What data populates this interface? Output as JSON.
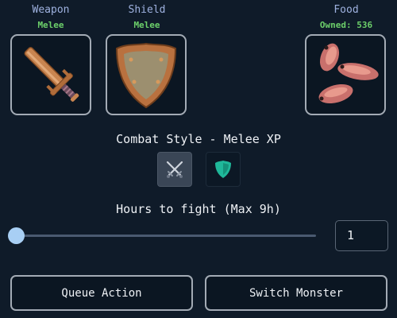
{
  "slots": [
    {
      "id": "weapon",
      "title": "Weapon",
      "subtitle": "Melee",
      "icon": "sword-icon"
    },
    {
      "id": "shield",
      "title": "Shield",
      "subtitle": "Melee",
      "icon": "shield-icon"
    },
    {
      "id": "food",
      "title": "Food",
      "subtitle": "Owned: 536",
      "icon": "fish-icon"
    }
  ],
  "combat_style": {
    "label": "Combat Style - Melee XP",
    "options": [
      {
        "icon": "crossed-swords-icon",
        "selected": true
      },
      {
        "icon": "green-shield-icon",
        "selected": false
      }
    ]
  },
  "hours": {
    "label": "Hours to fight (Max 9h)",
    "value": "1",
    "max": 9
  },
  "actions": {
    "queue": "Queue Action",
    "switch": "Switch Monster"
  },
  "colors": {
    "background": "#0f1b29",
    "slot_title": "#9fb2e0",
    "slot_sub": "#6ccf6a",
    "slider_thumb": "#a8cff4"
  }
}
